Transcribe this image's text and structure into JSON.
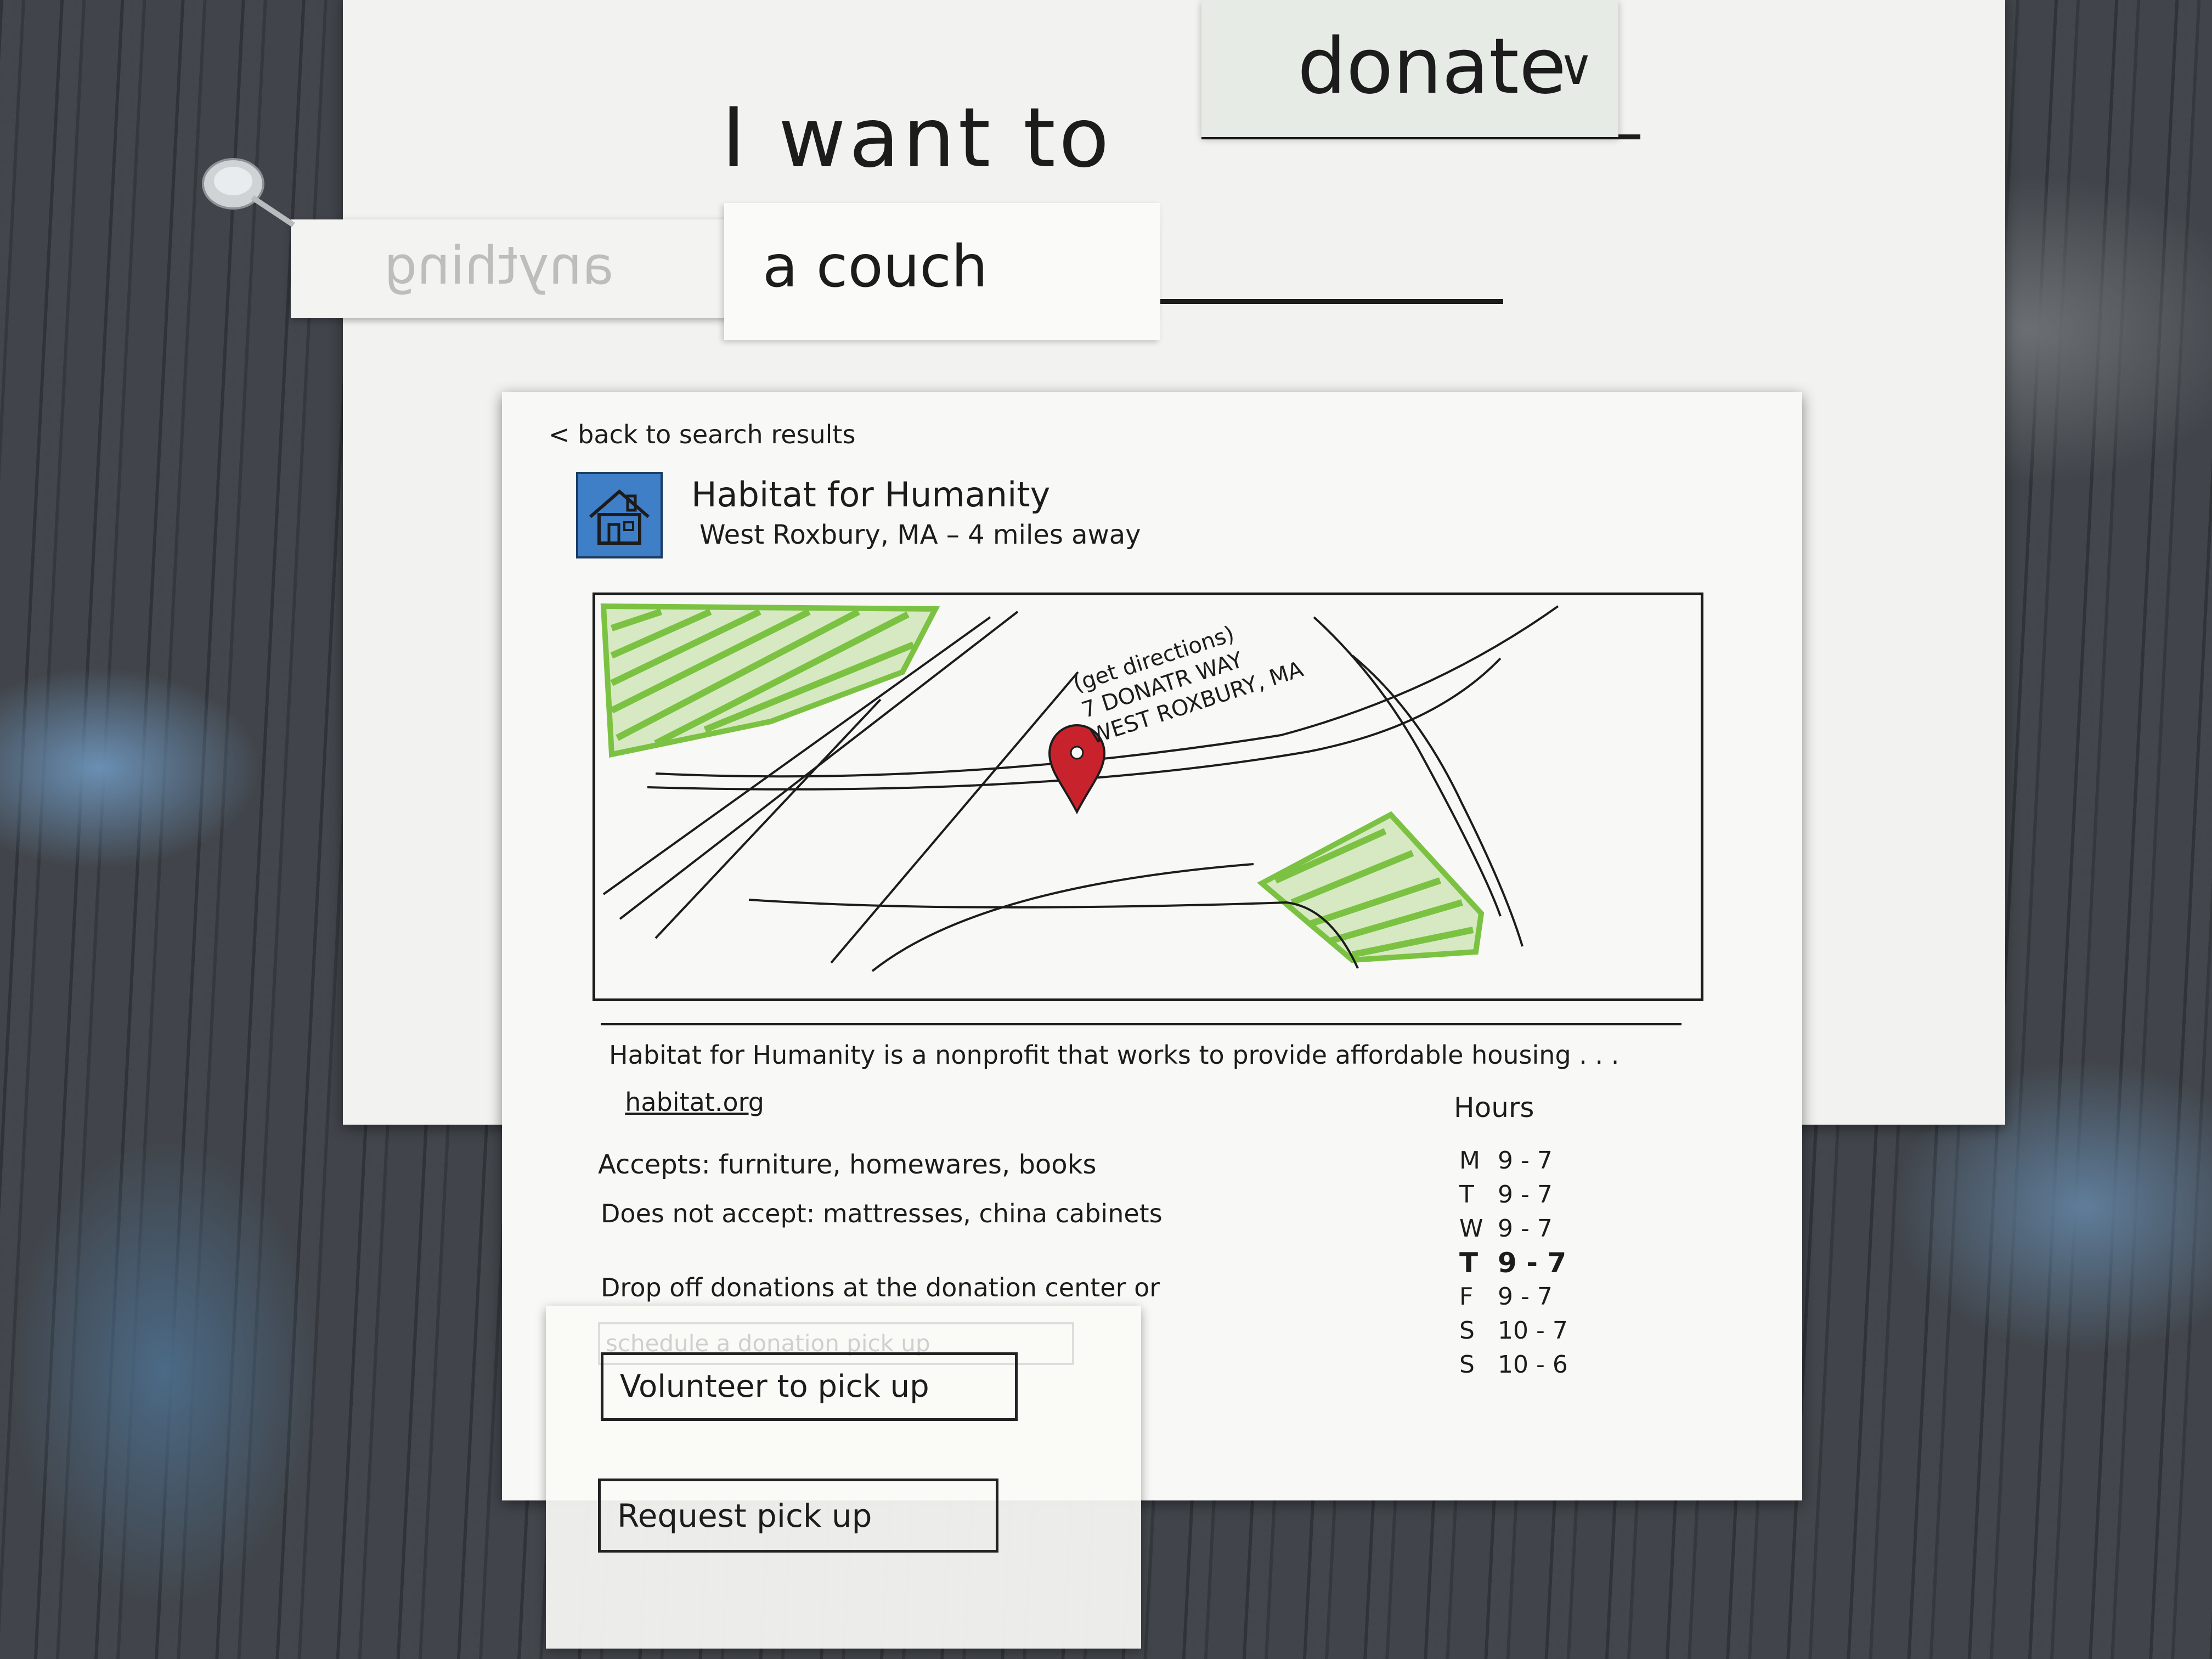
{
  "header": {
    "prompt_text": "I want to",
    "action_dropdown": {
      "selected": "donate"
    },
    "item_field": {
      "value": "a couch",
      "hidden_option": "anything"
    }
  },
  "detail": {
    "back_link": "< back to search results",
    "org": {
      "name": "Habitat for Humanity",
      "location": "West Roxbury, MA  –  4 miles away"
    },
    "map": {
      "directions_link": "(get directions)",
      "address_line1": "7 DONATR WAY",
      "address_line2": "WEST ROXBURY, MA",
      "pin_color": "#c8232c",
      "park_color": "#7cc242"
    },
    "description": "Habitat for Humanity is a nonprofit that works to provide affordable housing . . .",
    "website": "habitat.org",
    "accepts": "Accepts:  furniture, homewares, books",
    "not_accepts": "Does not accept:  mattresses, china cabinets",
    "dropoff": "Drop off donations at the donation center or",
    "hours": {
      "title": "Hours",
      "days": [
        {
          "day": "M",
          "time": "9 - 7"
        },
        {
          "day": "T",
          "time": "9 - 7"
        },
        {
          "day": "W",
          "time": "9 - 7"
        },
        {
          "day": "T",
          "time": "9 - 7"
        },
        {
          "day": "F",
          "time": "9 - 7"
        },
        {
          "day": "S",
          "time": "10 - 7"
        },
        {
          "day": "S",
          "time": "10 - 6"
        }
      ]
    }
  },
  "buttons": {
    "faded_label": "schedule a donation pick up",
    "volunteer_label": "Volunteer to pick up",
    "request_label": "Request  pick up"
  }
}
